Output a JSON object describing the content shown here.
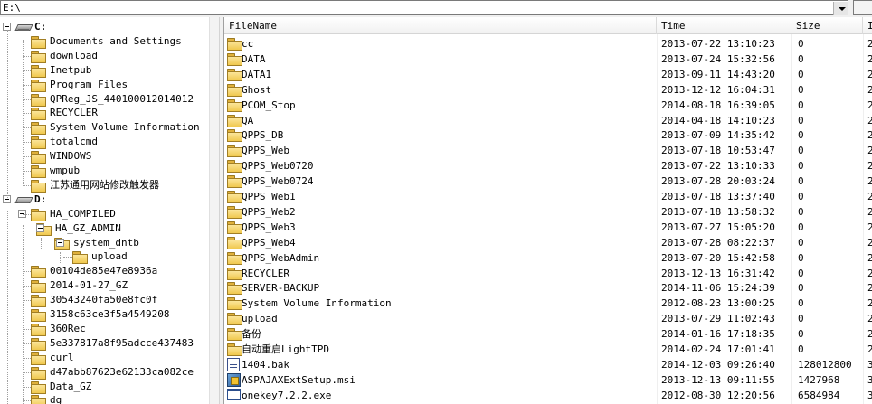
{
  "path_bar": {
    "value": "E:\\"
  },
  "tree": {
    "items": [
      {
        "label": "C:",
        "type": "drive"
      },
      {
        "label": "Documents and Settings",
        "type": "folder"
      },
      {
        "label": "download",
        "type": "folder"
      },
      {
        "label": "Inetpub",
        "type": "folder"
      },
      {
        "label": "Program Files",
        "type": "folder"
      },
      {
        "label": "QPReg_JS_440100012014012",
        "type": "folder"
      },
      {
        "label": "RECYCLER",
        "type": "folder"
      },
      {
        "label": "System Volume Information",
        "type": "folder"
      },
      {
        "label": "totalcmd",
        "type": "folder"
      },
      {
        "label": "WINDOWS",
        "type": "folder"
      },
      {
        "label": "wmpub",
        "type": "folder"
      },
      {
        "label": "江苏通用网站修改触发器",
        "type": "folder"
      },
      {
        "label": "D:",
        "type": "drive"
      },
      {
        "label": "HA_COMPILED",
        "type": "folder"
      },
      {
        "label": "HA_GZ_ADMIN",
        "type": "folder"
      },
      {
        "label": "system_dntb",
        "type": "folder"
      },
      {
        "label": "upload",
        "type": "folder"
      },
      {
        "label": "00104de85e47e8936a",
        "type": "folder"
      },
      {
        "label": "2014-01-27_GZ",
        "type": "folder"
      },
      {
        "label": "30543240fa50e8fc0f",
        "type": "folder"
      },
      {
        "label": "3158c63ce3f5a4549208",
        "type": "folder"
      },
      {
        "label": "360Rec",
        "type": "folder"
      },
      {
        "label": "5e337817a8f95adcce437483",
        "type": "folder"
      },
      {
        "label": "curl",
        "type": "folder"
      },
      {
        "label": "d47abb87623e62133ca082ce",
        "type": "folder"
      },
      {
        "label": "Data_GZ",
        "type": "folder"
      },
      {
        "label": "dg",
        "type": "folder"
      }
    ]
  },
  "file_list": {
    "columns": [
      "FileName",
      "Time",
      "Size",
      "I"
    ],
    "rows": [
      {
        "name": "cc",
        "time": "2013-07-22 13:10:23",
        "size": "0",
        "type": "folder",
        "extra": "2"
      },
      {
        "name": "DATA",
        "time": "2013-07-24 15:32:56",
        "size": "0",
        "type": "folder",
        "extra": "2"
      },
      {
        "name": "DATA1",
        "time": "2013-09-11 14:43:20",
        "size": "0",
        "type": "folder",
        "extra": "2"
      },
      {
        "name": "Ghost",
        "time": "2013-12-12 16:04:31",
        "size": "0",
        "type": "folder",
        "extra": "2"
      },
      {
        "name": "PCOM_Stop",
        "time": "2014-08-18 16:39:05",
        "size": "0",
        "type": "folder",
        "extra": "2"
      },
      {
        "name": "QA",
        "time": "2014-04-18 14:10:23",
        "size": "0",
        "type": "folder",
        "extra": "2"
      },
      {
        "name": "QPPS_DB",
        "time": "2013-07-09 14:35:42",
        "size": "0",
        "type": "folder",
        "extra": "2"
      },
      {
        "name": "QPPS_Web",
        "time": "2013-07-18 10:53:47",
        "size": "0",
        "type": "folder",
        "extra": "2"
      },
      {
        "name": "QPPS_Web0720",
        "time": "2013-07-22 13:10:33",
        "size": "0",
        "type": "folder",
        "extra": "2"
      },
      {
        "name": "QPPS_Web0724",
        "time": "2013-07-28 20:03:24",
        "size": "0",
        "type": "folder",
        "extra": "2"
      },
      {
        "name": "QPPS_Web1",
        "time": "2013-07-18 13:37:40",
        "size": "0",
        "type": "folder",
        "extra": "2"
      },
      {
        "name": "QPPS_Web2",
        "time": "2013-07-18 13:58:32",
        "size": "0",
        "type": "folder",
        "extra": "2"
      },
      {
        "name": "QPPS_Web3",
        "time": "2013-07-27 15:05:20",
        "size": "0",
        "type": "folder",
        "extra": "2"
      },
      {
        "name": "QPPS_Web4",
        "time": "2013-07-28 08:22:37",
        "size": "0",
        "type": "folder",
        "extra": "2"
      },
      {
        "name": "QPPS_WebAdmin",
        "time": "2013-07-20 15:42:58",
        "size": "0",
        "type": "folder",
        "extra": "2"
      },
      {
        "name": "RECYCLER",
        "time": "2013-12-13 16:31:42",
        "size": "0",
        "type": "folder",
        "extra": "2"
      },
      {
        "name": "SERVER-BACKUP",
        "time": "2014-11-06 15:24:39",
        "size": "0",
        "type": "folder",
        "extra": "2"
      },
      {
        "name": "System Volume Information",
        "time": "2012-08-23 13:00:25",
        "size": "0",
        "type": "folder",
        "extra": "2"
      },
      {
        "name": "upload",
        "time": "2013-07-29 11:02:43",
        "size": "0",
        "type": "folder",
        "extra": "2"
      },
      {
        "name": "备份",
        "time": "2014-01-16 17:18:35",
        "size": "0",
        "type": "folder",
        "extra": "2"
      },
      {
        "name": "自动重启LightTPD",
        "time": "2014-02-24 17:01:41",
        "size": "0",
        "type": "folder",
        "extra": "2"
      },
      {
        "name": "1404.bak",
        "time": "2014-12-03 09:26:40",
        "size": "128012800",
        "type": "bak",
        "extra": "3"
      },
      {
        "name": "ASPAJAXExtSetup.msi",
        "time": "2013-12-13 09:11:55",
        "size": "1427968",
        "type": "msi",
        "extra": "3"
      },
      {
        "name": "onekey7.2.2.exe",
        "time": "2012-08-30 12:20:56",
        "size": "6584984",
        "type": "exe",
        "extra": "3"
      }
    ]
  }
}
